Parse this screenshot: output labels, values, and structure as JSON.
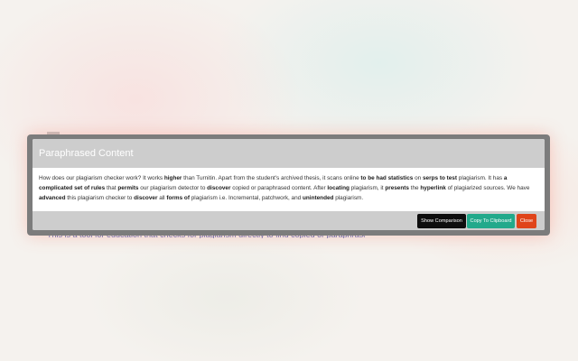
{
  "modal": {
    "title": "Paraphrased Content",
    "body": [
      {
        "t": "How does our plagiarism checker work? It works ",
        "b": false
      },
      {
        "t": "higher",
        "b": true
      },
      {
        "t": " than Turnitin. Apart from the student's archived thesis, it scans online ",
        "b": false
      },
      {
        "t": "to be had statistics",
        "b": true
      },
      {
        "t": " on ",
        "b": false
      },
      {
        "t": "serps to test",
        "b": true
      },
      {
        "t": " plagiarism. It has ",
        "b": false
      },
      {
        "t": "a complicated set of rules",
        "b": true
      },
      {
        "t": " that ",
        "b": false
      },
      {
        "t": "permits",
        "b": true
      },
      {
        "t": " our plagiarism detector to ",
        "b": false
      },
      {
        "t": "discover",
        "b": true
      },
      {
        "t": " copied or paraphrased content. After ",
        "b": false
      },
      {
        "t": "locating",
        "b": true
      },
      {
        "t": " plagiarism, it ",
        "b": false
      },
      {
        "t": "presents",
        "b": true
      },
      {
        "t": " the ",
        "b": false
      },
      {
        "t": "hyperlink",
        "b": true
      },
      {
        "t": " of plagiarized sources. We have ",
        "b": false
      },
      {
        "t": "advanced",
        "b": true
      },
      {
        "t": " this plagiarism checker to ",
        "b": false
      },
      {
        "t": "discover",
        "b": true
      },
      {
        "t": " all ",
        "b": false
      },
      {
        "t": "forms of",
        "b": true
      },
      {
        "t": " plagiarism i.e.  Incremental, patchwork, and ",
        "b": false
      },
      {
        "t": "unintended",
        "b": true
      },
      {
        "t": " plagiarism.",
        "b": false
      }
    ],
    "buttons": {
      "show_comparison": "Show Comparison",
      "copy_to_clipboard": "Copy To Clipboard",
      "close": "Close"
    }
  },
  "background": {
    "underlined_text": "This is a tool for education that checks for plagiarism directly to find copied or paraphrased"
  },
  "colors": {
    "header_footer": "#cdcdcd",
    "show_comparison_button": "#0e0e0e",
    "copy_button": "#22a98b",
    "close_button": "#e0441a"
  }
}
